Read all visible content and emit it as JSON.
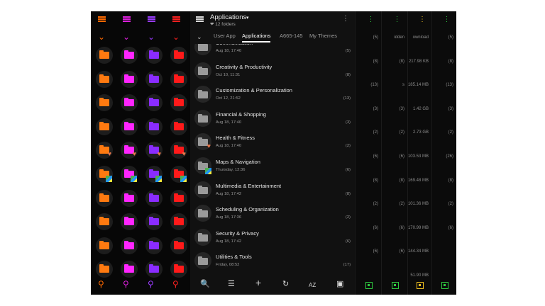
{
  "left_strips": [
    {
      "accent": "#ff6a00",
      "folder": "#ff7a10"
    },
    {
      "accent": "#e020e0",
      "folder": "#ff25ff"
    },
    {
      "accent": "#9a3cff",
      "folder": "#8a2cff"
    },
    {
      "accent": "#ff2020",
      "folder": "#ff1a1a"
    }
  ],
  "main": {
    "title": "Applications",
    "caret": "▾",
    "subtitle": "❤ 12 folders",
    "menu": "⋮",
    "tabs_chevron": "⌄",
    "tabs": [
      "User App",
      "Applications",
      "A665-145",
      "My Themes"
    ],
    "active_tab": 1,
    "rows": [
      {
        "name": "Communication",
        "date": "Aug 18, 17:40",
        "count": "(5)",
        "badge": ""
      },
      {
        "name": "Creativity & Productivity",
        "date": "Oct 10, 11:31",
        "count": "(8)",
        "badge": ""
      },
      {
        "name": "Customization & Personalization",
        "date": "Oct 12, 21:52",
        "count": "(13)",
        "badge": ""
      },
      {
        "name": "Financial & Shopping",
        "date": "Aug 18, 17:40",
        "count": "(3)",
        "badge": ""
      },
      {
        "name": "Health & Fitness",
        "date": "Aug 18, 17:40",
        "count": "(2)",
        "badge": "heart"
      },
      {
        "name": "Maps & Navigation",
        "date": "Thursday, 12:36",
        "count": "(6)",
        "badge": "map"
      },
      {
        "name": "Multimedia & Entertainment",
        "date": "Aug 18, 17:42",
        "count": "(8)",
        "badge": ""
      },
      {
        "name": "Scheduling & Organization",
        "date": "Aug 18, 17:36",
        "count": "(2)",
        "badge": ""
      },
      {
        "name": "Security & Privacy",
        "date": "Aug 18, 17:42",
        "count": "(6)",
        "badge": ""
      },
      {
        "name": "Utilities & Tools",
        "date": "Friday, 08:52",
        "count": "(17)",
        "badge": ""
      }
    ],
    "footer": {
      "search": "🔍",
      "list": "☰",
      "add": "+",
      "refresh": "↻",
      "sort": "AZ",
      "select": "▣"
    }
  },
  "right_strips": [
    {
      "accent": "#2ecc40",
      "texts": [
        "(5)",
        "(8)",
        "(13)",
        "(3)",
        "(2)",
        "(6)",
        "(8)",
        "(2)",
        "(6)",
        "(6)"
      ]
    },
    {
      "accent": "#2ecc40",
      "texts": [
        "idden",
        "(8)",
        "s",
        "(3)",
        "(2)",
        "(6)",
        "(8)",
        "(2)",
        "(6)",
        "(6)"
      ]
    },
    {
      "accent": "#f0c020",
      "texts": [
        "ownload",
        "217.98 KB",
        "185.14 MB",
        "1.42 GB",
        "2.73 GB",
        "103.53 MB",
        "169.48 MB",
        "101.36 MB",
        "170.99 MB",
        "144.34 MB",
        "51.90 MB"
      ]
    },
    {
      "accent": "#2ecc40",
      "texts": [
        "(5)",
        "(8)",
        "(13)",
        "(3)",
        "(2)",
        "(26)",
        "(8)",
        "(2)",
        "(6)"
      ]
    }
  ]
}
